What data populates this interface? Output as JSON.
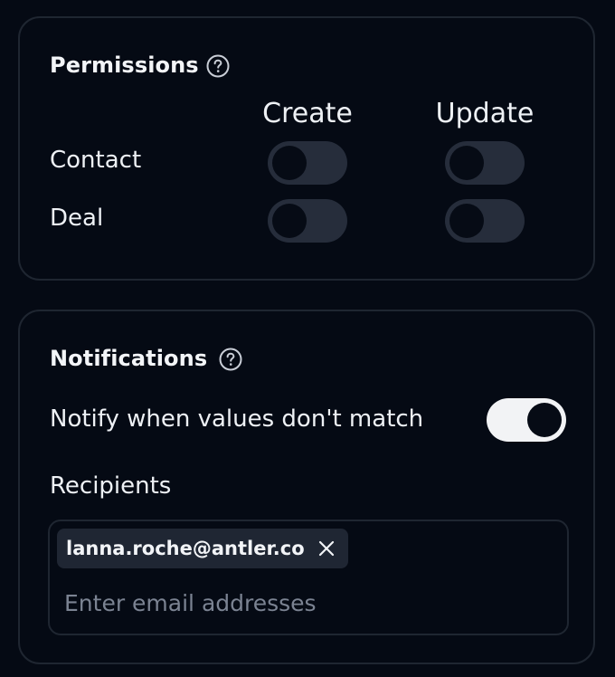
{
  "permissions": {
    "title": "Permissions",
    "help_icon": "question-circle-icon",
    "columns": [
      "Create",
      "Update"
    ],
    "rows": [
      {
        "label": "Contact",
        "create": false,
        "update": false
      },
      {
        "label": "Deal",
        "create": false,
        "update": false
      }
    ]
  },
  "notifications": {
    "title": "Notifications",
    "help_icon": "question-circle-icon",
    "mismatch_label": "Notify when values don't match",
    "mismatch_enabled": true,
    "recipients_label": "Recipients",
    "recipients": [
      "lanna.roche@antler.co"
    ],
    "remove_icon": "close-icon",
    "email_placeholder": "Enter email addresses"
  },
  "colors": {
    "background": "#050a14",
    "card_border": "#1f2631",
    "toggle_off_track": "#262d3b",
    "toggle_on_track": "#f2f3f5",
    "chip_background": "#1f2633",
    "placeholder_text": "#7b8392"
  }
}
